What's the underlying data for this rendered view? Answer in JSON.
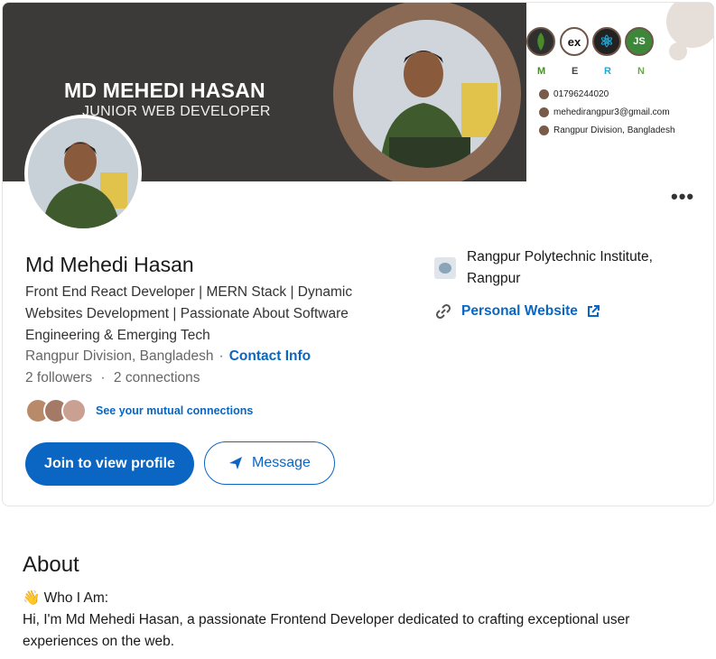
{
  "banner": {
    "name": "MD MEHEDI HASAN",
    "role": "JUNIOR WEB DEVELOPER",
    "stack_badges": [
      {
        "icon": "mongodb-leaf-icon",
        "text": "",
        "color": "#4a8a2b"
      },
      {
        "icon": "express-icon",
        "text": "ex",
        "color": "#111111"
      },
      {
        "icon": "react-atom-icon",
        "text": "⚛",
        "color": "#1fa9d6"
      },
      {
        "icon": "nodejs-icon",
        "text": "JS",
        "color": "#3c873a"
      }
    ],
    "mern_letters": [
      "M",
      "E",
      "R",
      "N"
    ],
    "mern_colors": [
      "#4a8a2b",
      "#444444",
      "#1fa9d6",
      "#6aa84f"
    ],
    "phone": "01796244020",
    "email": "mehedirangpur3@gmail.com",
    "address": "Rangpur Division, Bangladesh"
  },
  "profile": {
    "name": "Md Mehedi Hasan",
    "headline": "Front End React Developer | MERN Stack | Dynamic Websites Development | Passionate About Software Engineering & Emerging Tech",
    "location": "Rangpur Division, Bangladesh",
    "separator": "·",
    "contact_info": "Contact Info",
    "followers": "2 followers",
    "connections": "2 connections",
    "mutual": "See your mutual connections",
    "more": "•••"
  },
  "actions": {
    "join": "Join to view profile",
    "message": "Message"
  },
  "sidebar": {
    "school": "Rangpur Polytechnic Institute, Rangpur",
    "website": "Personal Website"
  },
  "about": {
    "title": "About",
    "who_emoji": "👋",
    "who": "Who I Am:",
    "text": "Hi, I'm Md Mehedi Hasan, a passionate Frontend Developer dedicated to crafting exceptional user experiences on the web."
  },
  "colors": {
    "accent": "#0a66c2",
    "banner_dark": "#3c3a39",
    "ring_brown": "#8a6a55"
  }
}
